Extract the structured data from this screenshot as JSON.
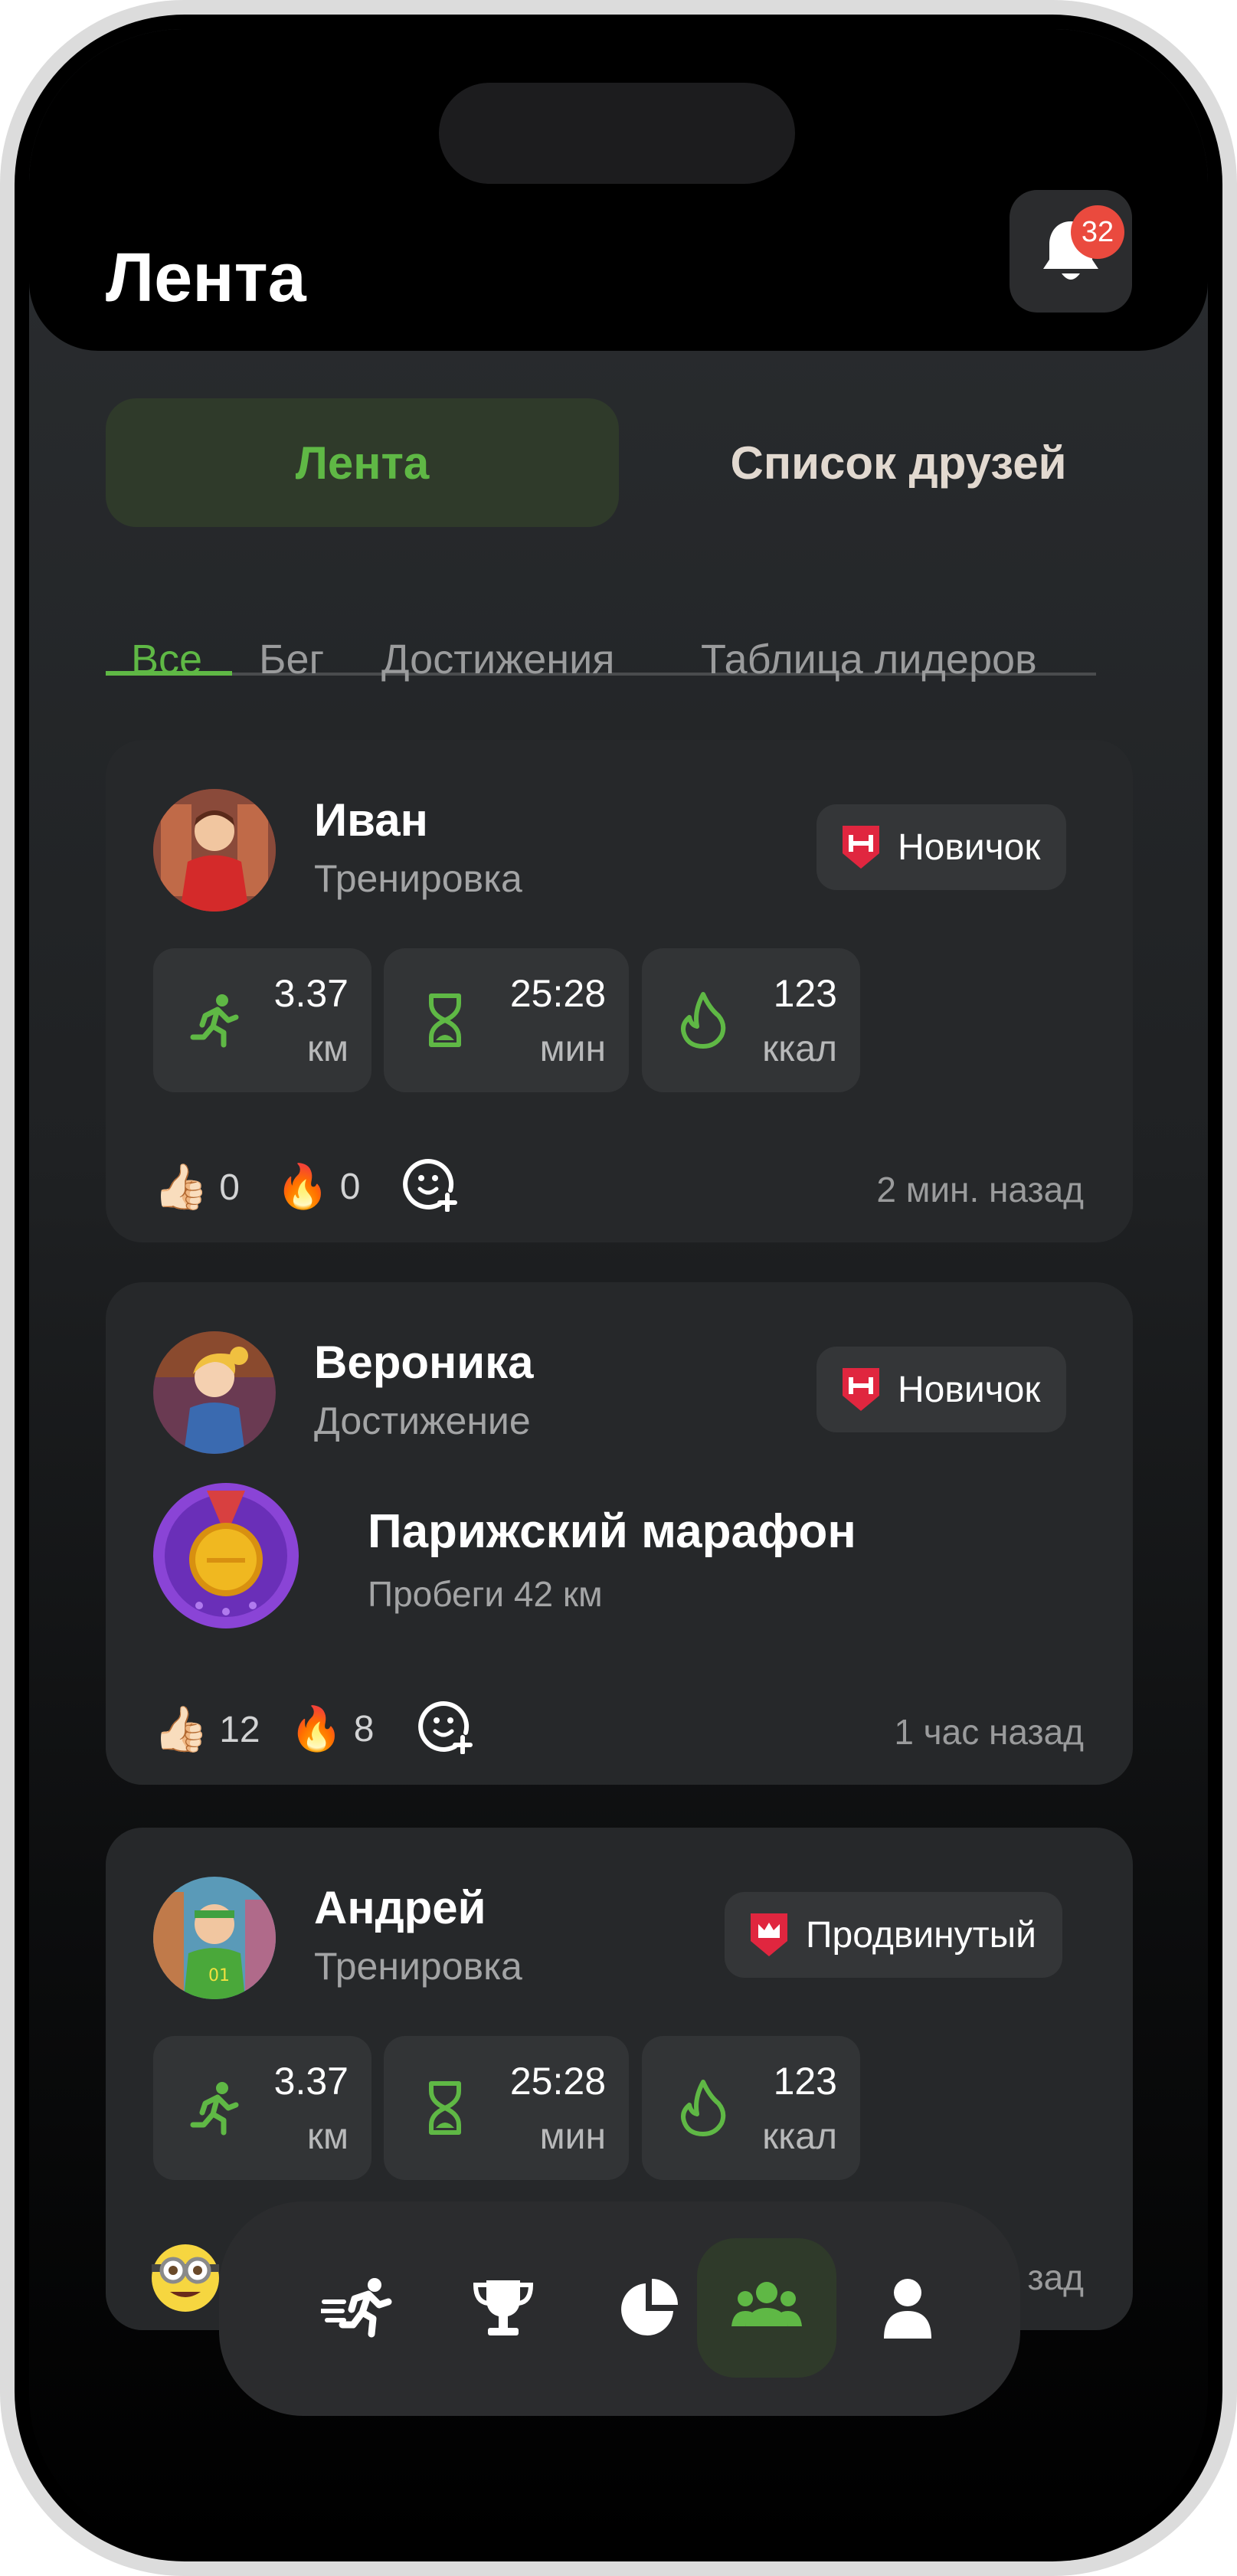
{
  "header": {
    "title": "Лента",
    "notifications_count": "32",
    "bell_icon": "bell-icon"
  },
  "segment": {
    "feed": "Лента",
    "friends": "Список друзей"
  },
  "tabs": [
    {
      "label": "Все",
      "active": true
    },
    {
      "label": "Бег",
      "active": false
    },
    {
      "label": "Достижения",
      "active": false
    },
    {
      "label": "Таблица лидеров",
      "active": false
    }
  ],
  "posts": [
    {
      "name": "Иван",
      "type": "Тренировка",
      "level": "Новичок",
      "stats": [
        {
          "icon": "running-icon",
          "value": "3.37",
          "unit": "км"
        },
        {
          "icon": "hourglass-icon",
          "value": "25:28",
          "unit": "мин"
        },
        {
          "icon": "flame-icon",
          "value": "123",
          "unit": "ккал"
        }
      ],
      "likes": "0",
      "fires": "0",
      "time": "2 мин. назад"
    },
    {
      "name": "Вероника",
      "type": "Достижение",
      "level": "Новичок",
      "achievement": {
        "title": "Парижский марафон",
        "description": "Пробеги 42 км"
      },
      "likes": "12",
      "fires": "8",
      "time": "1 час назад"
    },
    {
      "name": "Андрей",
      "type": "Тренировка",
      "level": "Продвинутый",
      "stats": [
        {
          "icon": "running-icon",
          "value": "3.37",
          "unit": "км"
        },
        {
          "icon": "hourglass-icon",
          "value": "25:28",
          "unit": "мин"
        },
        {
          "icon": "flame-icon",
          "value": "123",
          "unit": "ккал"
        }
      ],
      "time_partial": "зад"
    }
  ],
  "navbar": {
    "items": [
      "run-icon",
      "trophy-icon",
      "pie-chart-icon",
      "community-icon",
      "profile-icon"
    ],
    "active": "community-icon"
  },
  "colors": {
    "accent": "#5fb845",
    "badge": "#ea4a3e",
    "level_red": "#e0263f"
  }
}
